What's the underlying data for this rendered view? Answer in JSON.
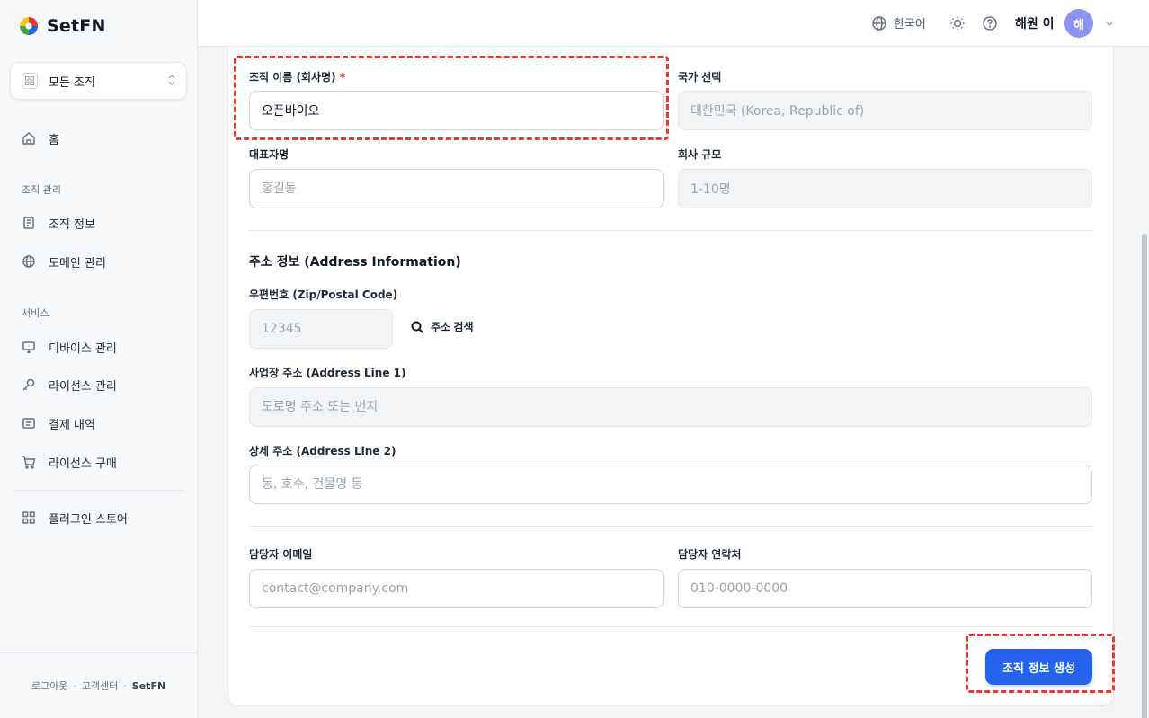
{
  "brand": {
    "name_prefix": "Set",
    "name_suffix": "FN"
  },
  "sidebar": {
    "org_selector": "모든 조직",
    "home": "홈",
    "section_org": "조직 관리",
    "org_info": "조직 정보",
    "domain": "도메인 관리",
    "section_service": "서비스",
    "devices": "디바이스 관리",
    "licenses": "라이선스 관리",
    "payments": "결제 내역",
    "purchase": "라이선스 구매",
    "plugins": "플러그인 스토어",
    "footer": {
      "logout": "로그아웃",
      "support": "고객센터",
      "brand": "SetFN",
      "separator": "·"
    }
  },
  "header": {
    "language": "한국어",
    "user_name": "해원 이",
    "avatar_initial": "해"
  },
  "form": {
    "org_name": {
      "label": "조직 이름 (회사명)",
      "required_mark": "*",
      "value": "오픈바이오"
    },
    "country": {
      "label": "국가 선택",
      "value": "대한민국 (Korea, Republic of)"
    },
    "ceo": {
      "label": "대표자명",
      "placeholder": "홍길동"
    },
    "company_size": {
      "label": "회사 규모",
      "value": "1-10명"
    },
    "address_section": "주소 정보 (Address Information)",
    "zip": {
      "label": "우편번호 (Zip/Postal Code)",
      "placeholder": "12345"
    },
    "address_search": "주소 검색",
    "address1": {
      "label": "사업장 주소 (Address Line 1)",
      "placeholder": "도로명 주소 또는 번지"
    },
    "address2": {
      "label": "상세 주소 (Address Line 2)",
      "placeholder": "동, 호수, 건물명 등"
    },
    "email": {
      "label": "담당자 이메일",
      "placeholder": "contact@company.com"
    },
    "phone": {
      "label": "담당자 연락처",
      "placeholder": "010-0000-0000"
    },
    "submit": "조직 정보 생성"
  },
  "colors": {
    "primary": "#2563eb",
    "highlight": "#e53935",
    "avatar": "#8b93f0"
  }
}
